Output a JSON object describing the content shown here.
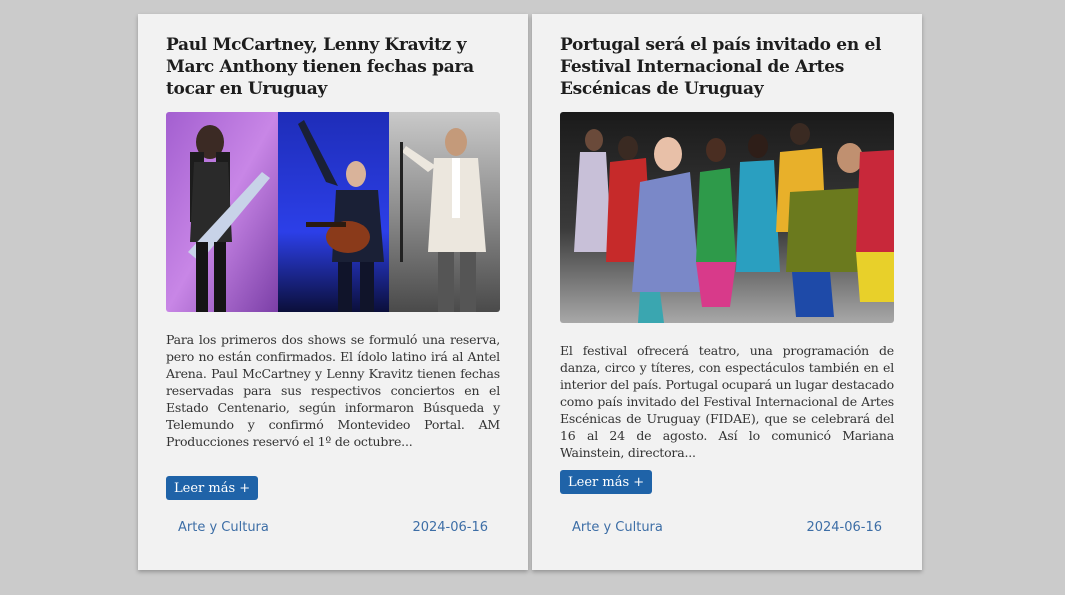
{
  "articles": [
    {
      "title": "Paul McCartney, Lenny Kravitz y Marc Anthony tienen fechas para tocar en Uruguay",
      "image": "collage of three performers on stage",
      "excerpt": "Para los primeros dos shows se formuló una reserva, pero no están confirmados. El ídolo latino irá al Antel Arena. Paul McCartney y Lenny Kravitz tienen fechas reservadas para sus respectivos conciertos en el Estado Centenario, según informaron Búsqueda y Telemundo y confirmó Montevideo Portal. AM Producciones reservó el 1º de octubre...",
      "read_more": "Leer más +",
      "category": "Arte y Cultura",
      "date": "2024-06-16"
    },
    {
      "title": "Portugal será el país invitado en el Festival Internacional de Artes Escénicas de Uruguay",
      "image": "dancers in colorful clothes performing on stage",
      "excerpt": "El festival ofrecerá teatro, una programación de danza, circo y títeres, con espectáculos también en el interior del país. Portugal ocupará un lugar destacado como país invitado del Festival Internacional de Artes Escénicas de Uruguay (FIDAE), que se celebrará del 16 al 24 de agosto. Así lo comunicó Mariana Wainstein, directora...",
      "read_more": "Leer más +",
      "category": "Arte y Cultura",
      "date": "2024-06-16"
    }
  ],
  "colors": {
    "page_bg": "#cbcbcb",
    "card_bg": "#f2f2f2",
    "button_bg": "#1f63a8",
    "link": "#3d6ea6"
  }
}
